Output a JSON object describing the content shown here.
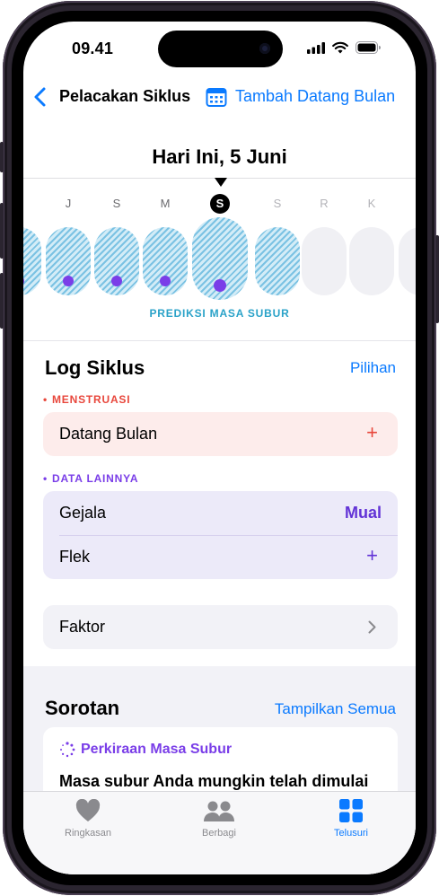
{
  "status_bar": {
    "time": "09.41"
  },
  "nav": {
    "title": "Pelacakan Siklus",
    "add_label": "Tambah Datang Bulan"
  },
  "day_header": {
    "title": "Hari Ini, 5 Juni"
  },
  "calendar": {
    "days": [
      {
        "letter": "",
        "fertile": true,
        "dot": true,
        "today": false
      },
      {
        "letter": "J",
        "fertile": true,
        "dot": true,
        "today": false
      },
      {
        "letter": "S",
        "fertile": true,
        "dot": true,
        "today": false
      },
      {
        "letter": "M",
        "fertile": true,
        "dot": true,
        "today": false
      },
      {
        "letter": "S",
        "fertile": true,
        "dot": true,
        "today": true
      },
      {
        "letter": "S",
        "fertile": true,
        "dot": false,
        "today": false
      },
      {
        "letter": "R",
        "fertile": false,
        "dot": false,
        "today": false
      },
      {
        "letter": "K",
        "fertile": false,
        "dot": false,
        "today": false
      },
      {
        "letter": "",
        "fertile": false,
        "dot": false,
        "today": false
      }
    ],
    "fertile_label": "PREDIKSI MASA SUBUR"
  },
  "log": {
    "title": "Log Siklus",
    "options_label": "Pilihan",
    "menstruation": {
      "header": "MENSTRUASI",
      "row_label": "Datang Bulan",
      "action": "+"
    },
    "other": {
      "header": "DATA LAINNYA",
      "rows": [
        {
          "label": "Gejala",
          "value": "Mual"
        },
        {
          "label": "Flek",
          "value": "+"
        }
      ]
    },
    "factors_label": "Faktor"
  },
  "highlights": {
    "title": "Sorotan",
    "show_all": "Tampilkan Semua",
    "card_title": "Perkiraan Masa Subur",
    "card_body": "Masa subur Anda mungkin telah dimulai"
  },
  "tabbar": {
    "tabs": [
      {
        "label": "Ringkasan",
        "icon": "heart-icon",
        "active": false
      },
      {
        "label": "Berbagi",
        "icon": "people-icon",
        "active": false
      },
      {
        "label": "Telusuri",
        "icon": "grid-icon",
        "active": true
      }
    ]
  },
  "colors": {
    "accent": "#0a7aff",
    "menstruation": "#e8473c",
    "other_data": "#7a3ee8",
    "fertile": "#76c0e2",
    "menstruation_card": "#fdeceb",
    "other_card": "#eceaf9"
  }
}
